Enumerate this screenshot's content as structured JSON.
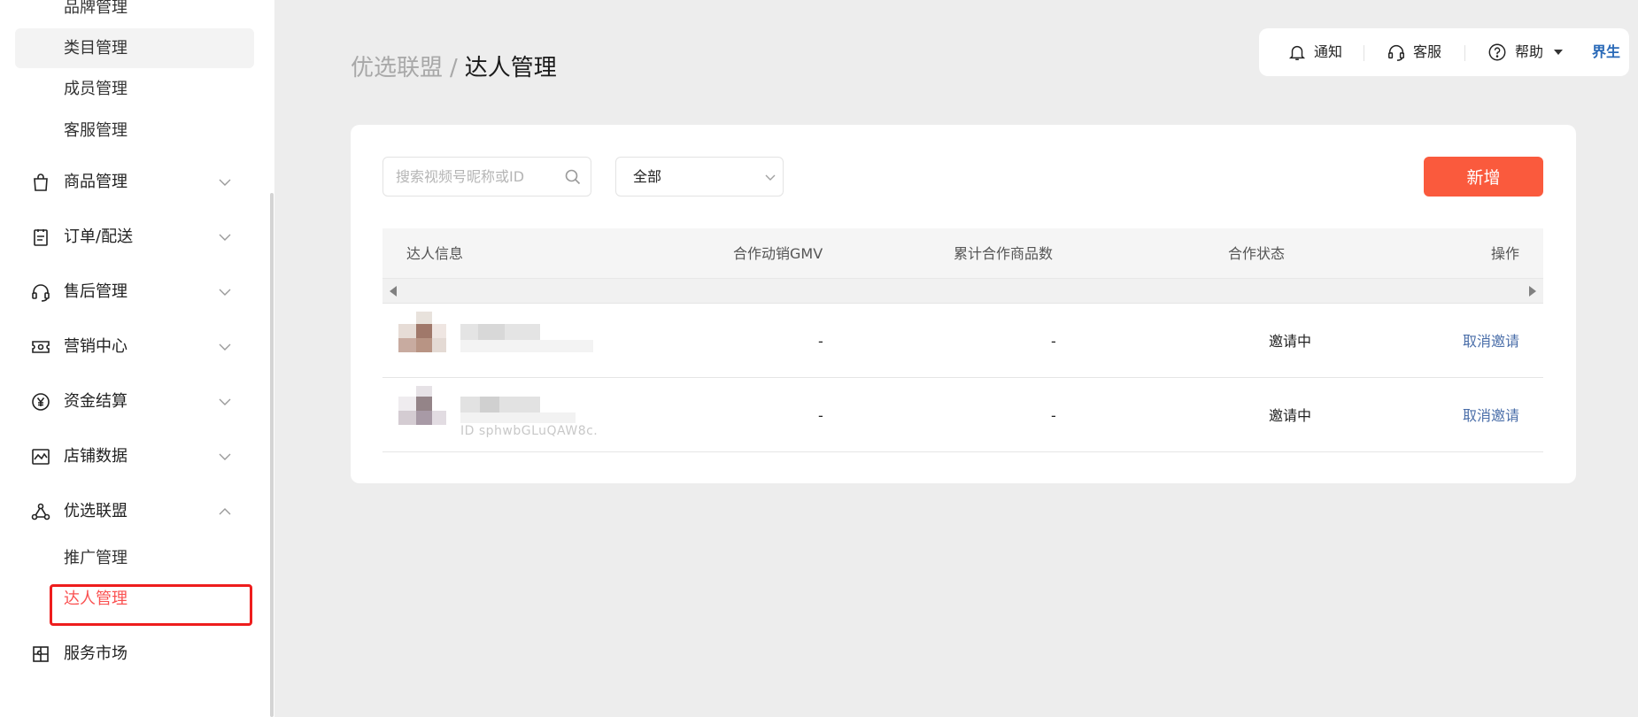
{
  "sidebar": {
    "top_items": [
      {
        "label": "品牌管理"
      },
      {
        "label": "类目管理"
      },
      {
        "label": "成员管理"
      },
      {
        "label": "客服管理"
      }
    ],
    "groups": [
      {
        "label": "商品管理",
        "icon": "shopping-bag-icon"
      },
      {
        "label": "订单/配送",
        "icon": "clipboard-icon"
      },
      {
        "label": "售后管理",
        "icon": "headset-icon"
      },
      {
        "label": "营销中心",
        "icon": "ticket-icon"
      },
      {
        "label": "资金结算",
        "icon": "yuan-coin-icon"
      },
      {
        "label": "店铺数据",
        "icon": "chart-icon"
      },
      {
        "label": "优选联盟",
        "icon": "network-icon",
        "expanded": true
      },
      {
        "label": "服务市场",
        "icon": "puzzle-icon"
      }
    ],
    "alliance_sub_items": [
      {
        "label": "推广管理"
      },
      {
        "label": "达人管理",
        "active": true
      }
    ],
    "active_color": "#fa5151"
  },
  "breadcrumb": {
    "parent": "优选联盟",
    "separator": "/",
    "current": "达人管理"
  },
  "topbar": {
    "notify": "通知",
    "service": "客服",
    "help": "帮助",
    "logo_text": "界生"
  },
  "toolbar": {
    "search_placeholder": "搜索视频号昵称或ID",
    "status_select": "全部",
    "add_button": "新增",
    "accent_color": "#fa5a3d"
  },
  "table": {
    "columns": [
      "达人信息",
      "合作动销GMV",
      "累计合作商品数",
      "合作状态",
      "操作"
    ],
    "rows": [
      {
        "gmv": "-",
        "product_count": "-",
        "status": "邀请中",
        "action": "取消邀请",
        "id_text": ""
      },
      {
        "gmv": "-",
        "product_count": "-",
        "status": "邀请中",
        "action": "取消邀请",
        "id_text": "ID sphwbGLuQAW8c."
      }
    ]
  }
}
